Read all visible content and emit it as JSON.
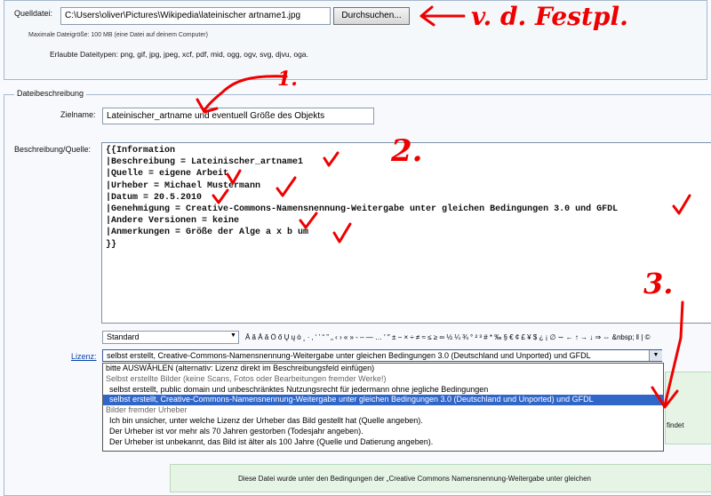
{
  "source_file": {
    "label": "Quelldatei:",
    "value": "C:\\Users\\oliver\\Pictures\\Wikipedia\\lateinischer artname1.jpg",
    "browse_button": "Durchsuchen...",
    "max_size_note": "Maximale Dateigröße: 100 MB (eine Datei auf deinem Computer)",
    "allowed_types": "Erlaubte Dateitypen: png, gif, jpg, jpeg, xcf, pdf, mid, ogg, ogv, svg, djvu, oga."
  },
  "description_section": {
    "legend": "Dateibeschreibung",
    "target_label": "Zielname:",
    "target_value": "Lateinischer_artname und eventuell Größe des Objekts",
    "desc_label": "Beschreibung/Quelle:",
    "desc_lines": [
      "{{Information",
      "|Beschreibung = Lateinischer_artname1",
      "|Quelle = eigene Arbeit",
      "|Urheber = Michael Mustermann",
      "|Datum = 20.5.2010",
      "|Genehmigung = Creative-Commons-Namensnennung-Weitergabe unter gleichen Bedingungen 3.0 und GFDL",
      "|Andere Versionen = keine",
      "|Anmerkungen = Größe der Alge a x b um",
      "}}"
    ],
    "format_select": "Standard",
    "special_chars": "Ā ă Ǎ ǎ Ő ő Ų ų ȯ ¸ · ‚ ‘ ’ “ ” „ ‹ › « » ‑ – — … ′ ″ ± − × ÷ ≠ ≈ ≤ ≥ ∞ ½ ¼ ¾ ° ² ³ # * ‰ § € ¢ £ ¥ $ ¿ ¡ ∅ ∼ ← ↑ → ↓ ⇒ ⇔ &nbsp; ‖ | ©"
  },
  "license": {
    "label": "Lizenz:",
    "selected": "selbst erstellt, Creative-Commons-Namensnennung-Weitergabe unter gleichen Bedingungen 3.0 (Deutschland und Unported) und GFDL",
    "options": [
      {
        "text": "bitte AUSWÄHLEN (alternativ: Lizenz direkt im Beschreibungsfeld einfügen)",
        "kind": "option"
      },
      {
        "text": "Selbst erstellte Bilder (keine Scans, Fotos oder Bearbeitungen fremder Werke!)",
        "kind": "group"
      },
      {
        "text": "selbst erstellt, public domain und unbeschränktes Nutzungsrecht für jedermann ohne jegliche Bedingungen",
        "kind": "option"
      },
      {
        "text": "selbst erstellt, Creative-Commons-Namensnennung-Weitergabe unter gleichen Bedingungen 3.0 (Deutschland und Unported) und GFDL",
        "kind": "selected"
      },
      {
        "text": "Bilder fremder Urheber",
        "kind": "group"
      },
      {
        "text": "Ich bin unsicher, unter welche Lizenz der Urheber das Bild gestellt hat (Quelle angeben).",
        "kind": "option"
      },
      {
        "text": "Der Urheber ist vor mehr als 70 Jahren gestorben (Todesjahr angeben).",
        "kind": "option"
      },
      {
        "text": "Der Urheber ist unbekannt, das Bild ist älter als 100 Jahre (Quelle und Datierung angeben).",
        "kind": "option"
      }
    ],
    "side_text": "findet",
    "notice": "Diese Datei wurde unter den Bedingungen der „Creative Commons Namensnennung-Weitergabe unter gleichen"
  },
  "annotations": {
    "source_note": "v. d. Festpl.",
    "step1": "1.",
    "step2": "2.",
    "step3": "3."
  },
  "colors": {
    "annotation": "#e00000",
    "selection": "#3166c9",
    "link": "#0645ad"
  }
}
